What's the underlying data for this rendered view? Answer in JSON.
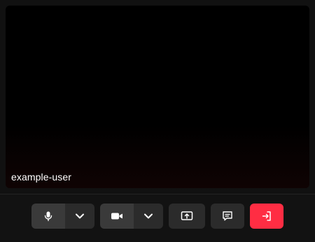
{
  "participant": {
    "name": "example-user"
  },
  "controls": {
    "microphone": {
      "icon": "microphone-icon",
      "options_icon": "chevron-down-icon"
    },
    "camera": {
      "icon": "video-camera-icon",
      "options_icon": "chevron-down-icon"
    },
    "screen_share": {
      "icon": "screen-share-icon"
    },
    "chat": {
      "icon": "chat-icon"
    },
    "leave": {
      "icon": "leave-icon",
      "color": "#ff2d43"
    }
  },
  "colors": {
    "background": "#111111",
    "video": "#000000",
    "button": "#2b2b2b",
    "button_active": "#3a3a3a",
    "leave": "#ff2d43"
  }
}
